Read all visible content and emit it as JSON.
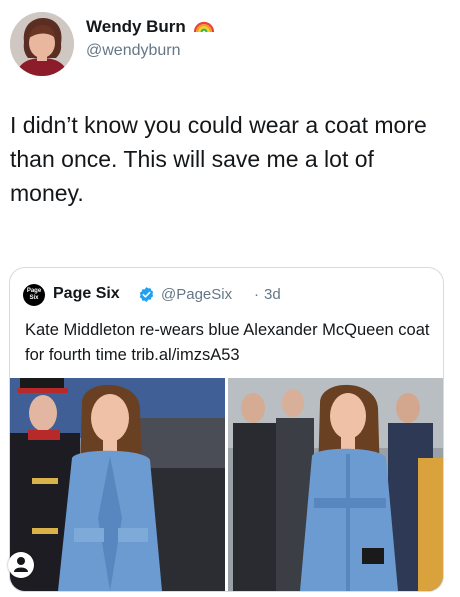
{
  "tweet": {
    "author_name": "Wendy Burn",
    "author_handle": "@wendyburn",
    "author_emoji": "rainbow-icon",
    "text": "I didn’t know you could wear a coat more than once. This will save me a lot of money."
  },
  "quoted_tweet": {
    "logo_text": "Page Six",
    "account_name": "Page Six",
    "verified": "verified-icon",
    "handle": "@PageSix",
    "separator": "·",
    "time": "3d",
    "text": "Kate Middleton re-wears blue Alexander McQueen coat for fourth time trib.al/imzsA53"
  },
  "colors": {
    "text_primary": "#14171a",
    "text_secondary": "#657786",
    "verified_blue": "#1da1f2",
    "card_border": "#d5dbe0",
    "coat_blue": "#6b9bd1"
  }
}
